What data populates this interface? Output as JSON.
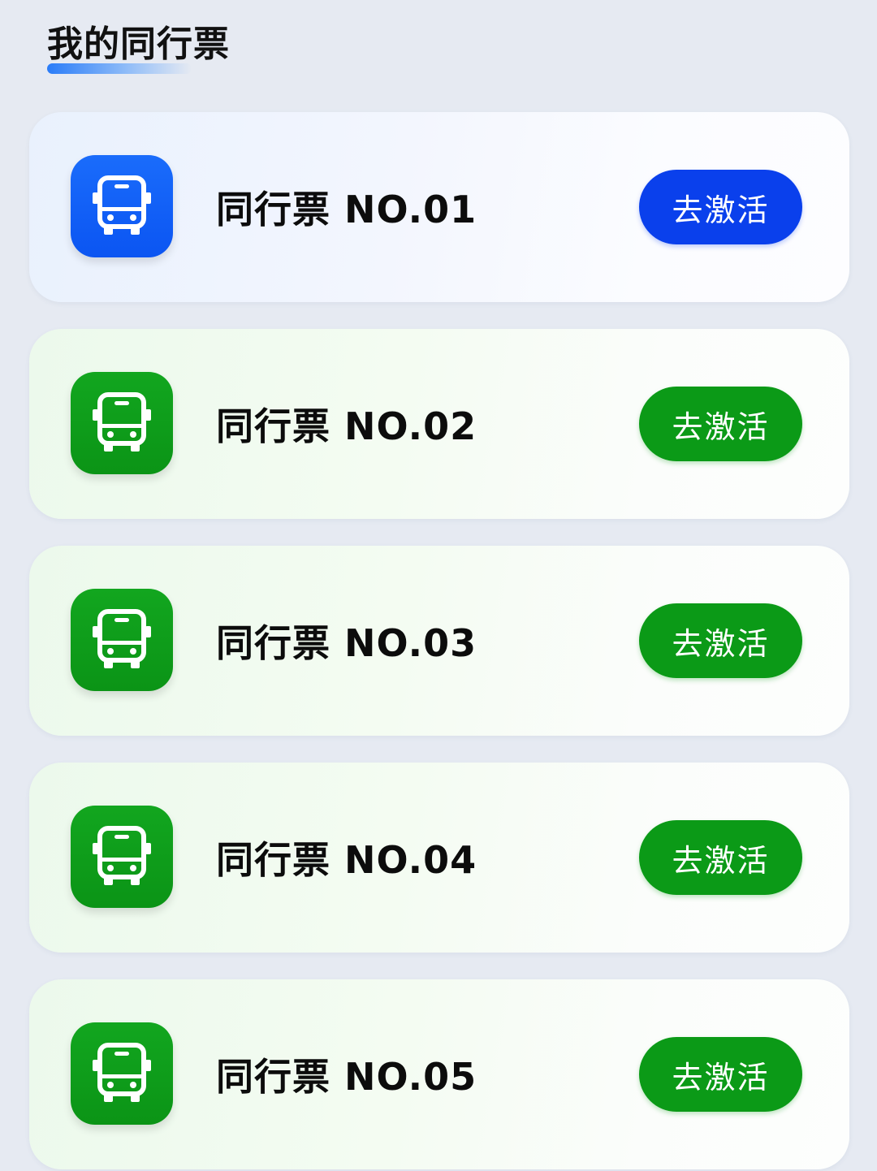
{
  "header": {
    "title": "我的同行票"
  },
  "colors": {
    "page_background": "#e6eaf2",
    "blue_accent": "#0a40ec",
    "green_accent": "#0b9a17"
  },
  "tickets": [
    {
      "name": "同行票 NO.01",
      "action_label": "去激活",
      "theme": "blue",
      "icon": "bus-icon"
    },
    {
      "name": "同行票 NO.02",
      "action_label": "去激活",
      "theme": "green",
      "icon": "bus-icon"
    },
    {
      "name": "同行票 NO.03",
      "action_label": "去激活",
      "theme": "green",
      "icon": "bus-icon"
    },
    {
      "name": "同行票 NO.04",
      "action_label": "去激活",
      "theme": "green",
      "icon": "bus-icon"
    },
    {
      "name": "同行票 NO.05",
      "action_label": "去激活",
      "theme": "green",
      "icon": "bus-icon"
    }
  ]
}
